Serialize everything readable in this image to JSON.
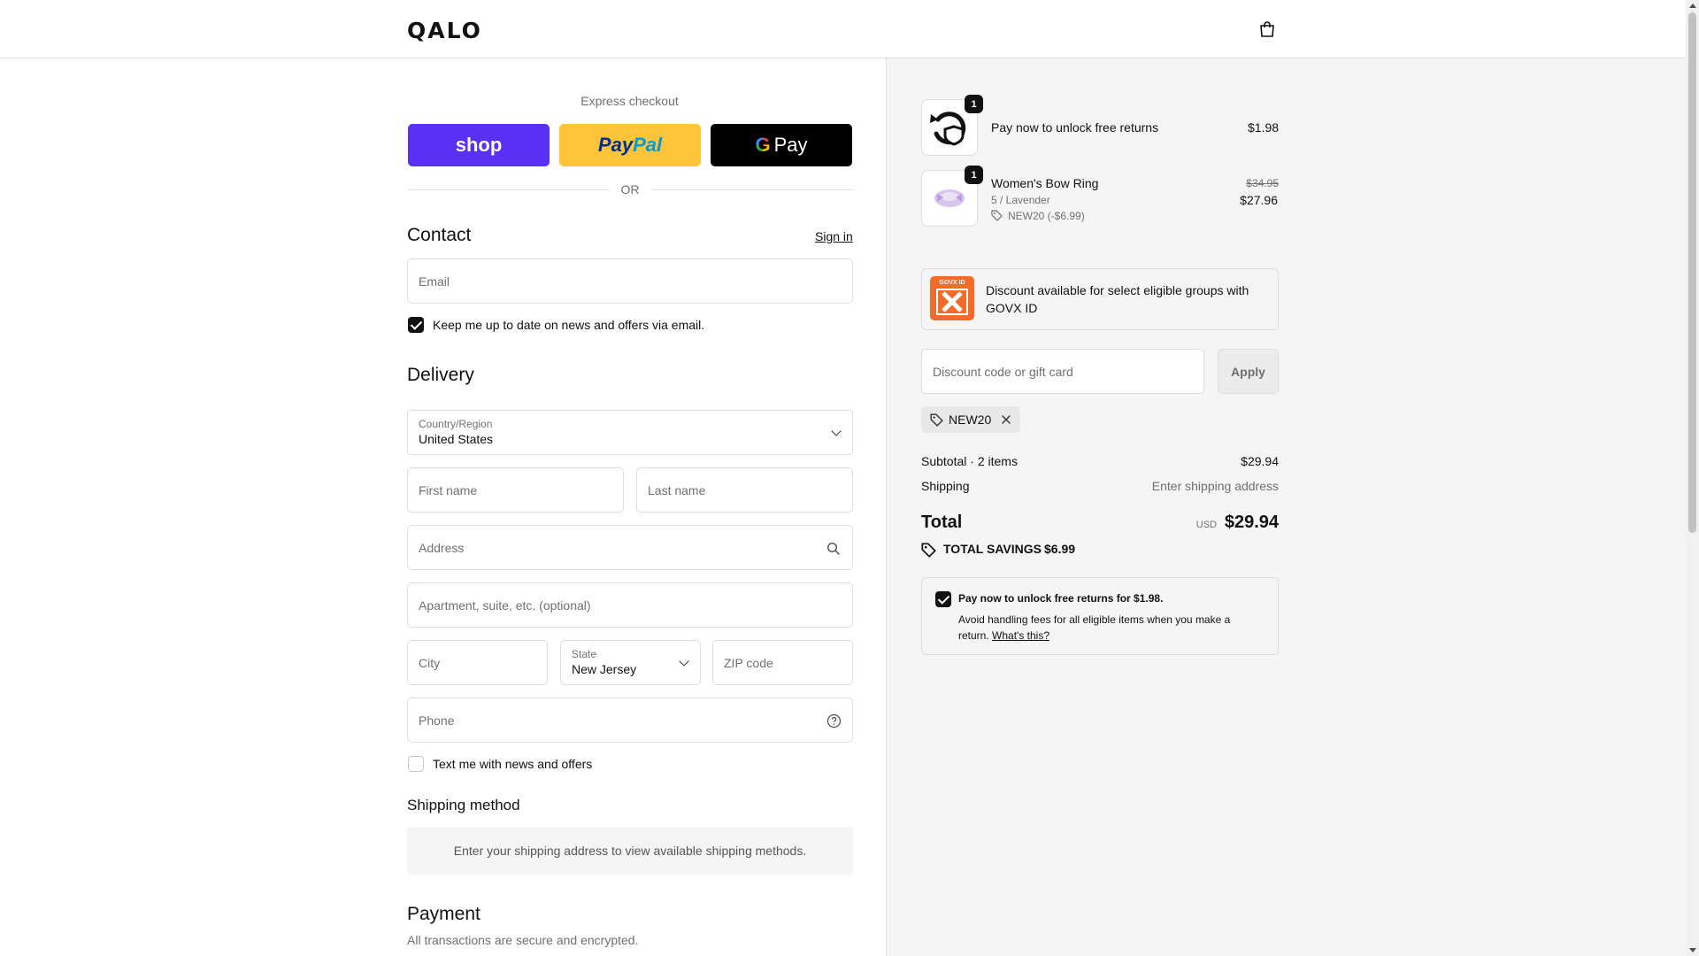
{
  "header": {
    "logo": "QALO",
    "cart_icon": "shopping-bag-icon"
  },
  "express": {
    "label": "Express checkout",
    "shop_label": "shop",
    "paypal_label_1": "Pay",
    "paypal_label_2": "Pal",
    "gpay_g": "G",
    "gpay_label": "Pay",
    "or": "OR"
  },
  "contact": {
    "title": "Contact",
    "sign_in": "Sign in",
    "email_placeholder": "Email",
    "newsletter_label": "Keep me up to date on news and offers via email.",
    "newsletter_checked": true
  },
  "delivery": {
    "title": "Delivery",
    "country_label": "Country/Region",
    "country_value": "United States",
    "first_name_placeholder": "First name",
    "last_name_placeholder": "Last name",
    "address_placeholder": "Address",
    "apartment_placeholder": "Apartment, suite, etc. (optional)",
    "city_placeholder": "City",
    "state_label": "State",
    "state_value": "New Jersey",
    "zip_placeholder": "ZIP code",
    "phone_placeholder": "Phone",
    "sms_label": "Text me with news and offers",
    "sms_checked": false
  },
  "shipping_method": {
    "title": "Shipping method",
    "notice": "Enter your shipping address to view available shipping methods."
  },
  "payment": {
    "title": "Payment",
    "subtitle": "All transactions are secure and encrypted."
  },
  "summary": {
    "items": [
      {
        "name": "Pay now to unlock free returns",
        "qty": "1",
        "price": "$1.98",
        "icon": "returns-shield-icon"
      },
      {
        "name": "Women's Bow Ring",
        "qty": "1",
        "variant": "5 / Lavender",
        "discount": "NEW20 (-$6.99)",
        "original_price": "$34.95",
        "price": "$27.96",
        "icon": "bow-ring-image"
      }
    ],
    "govx_logo_text": "GOVX ID",
    "govx_text": "Discount available for select eligible groups with GOVX ID",
    "discount_placeholder": "Discount code or gift card",
    "apply_label": "Apply",
    "applied_code": "NEW20",
    "subtotal_label": "Subtotal · 2 items",
    "subtotal_value": "$29.94",
    "shipping_label": "Shipping",
    "shipping_value": "Enter shipping address",
    "total_label": "Total",
    "currency": "USD",
    "total_value": "$29.94",
    "savings_label": "TOTAL SAVINGS",
    "savings_value": "$6.99",
    "returns_title": "Pay now to unlock free returns for $1.98.",
    "returns_desc": "Avoid handling fees for all eligible items when you make a return.",
    "returns_link": "What's this?",
    "returns_checked": true
  }
}
